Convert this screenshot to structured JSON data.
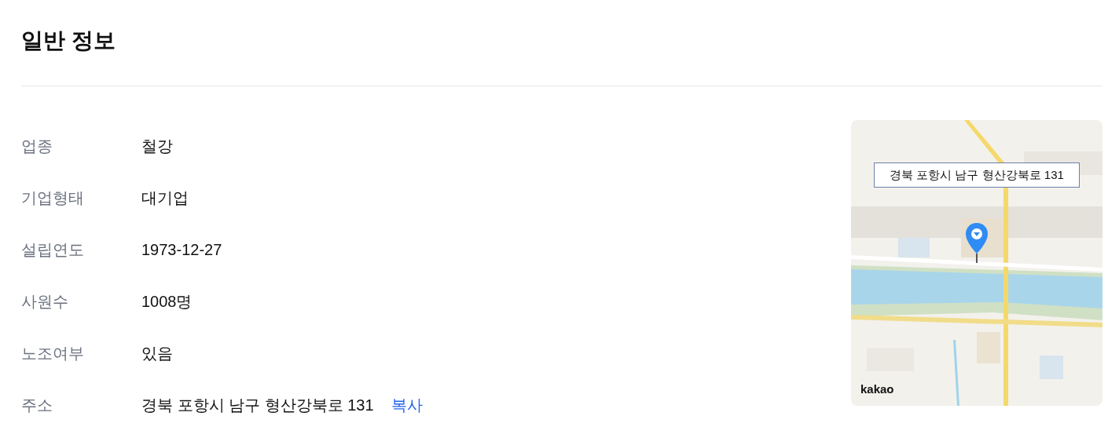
{
  "section": {
    "title": "일반 정보"
  },
  "fields": [
    {
      "label": "업종",
      "value": "철강"
    },
    {
      "label": "기업형태",
      "value": "대기업"
    },
    {
      "label": "설립연도",
      "value": "1973-12-27"
    },
    {
      "label": "사원수",
      "value": "1008명"
    },
    {
      "label": "노조여부",
      "value": "있음"
    },
    {
      "label": "주소",
      "value": "경북 포항시 남구 형산강북로 131",
      "action": "복사"
    }
  ],
  "map": {
    "info_window": "경북 포항시 남구 형산강북로 131",
    "logo": "kakao"
  }
}
